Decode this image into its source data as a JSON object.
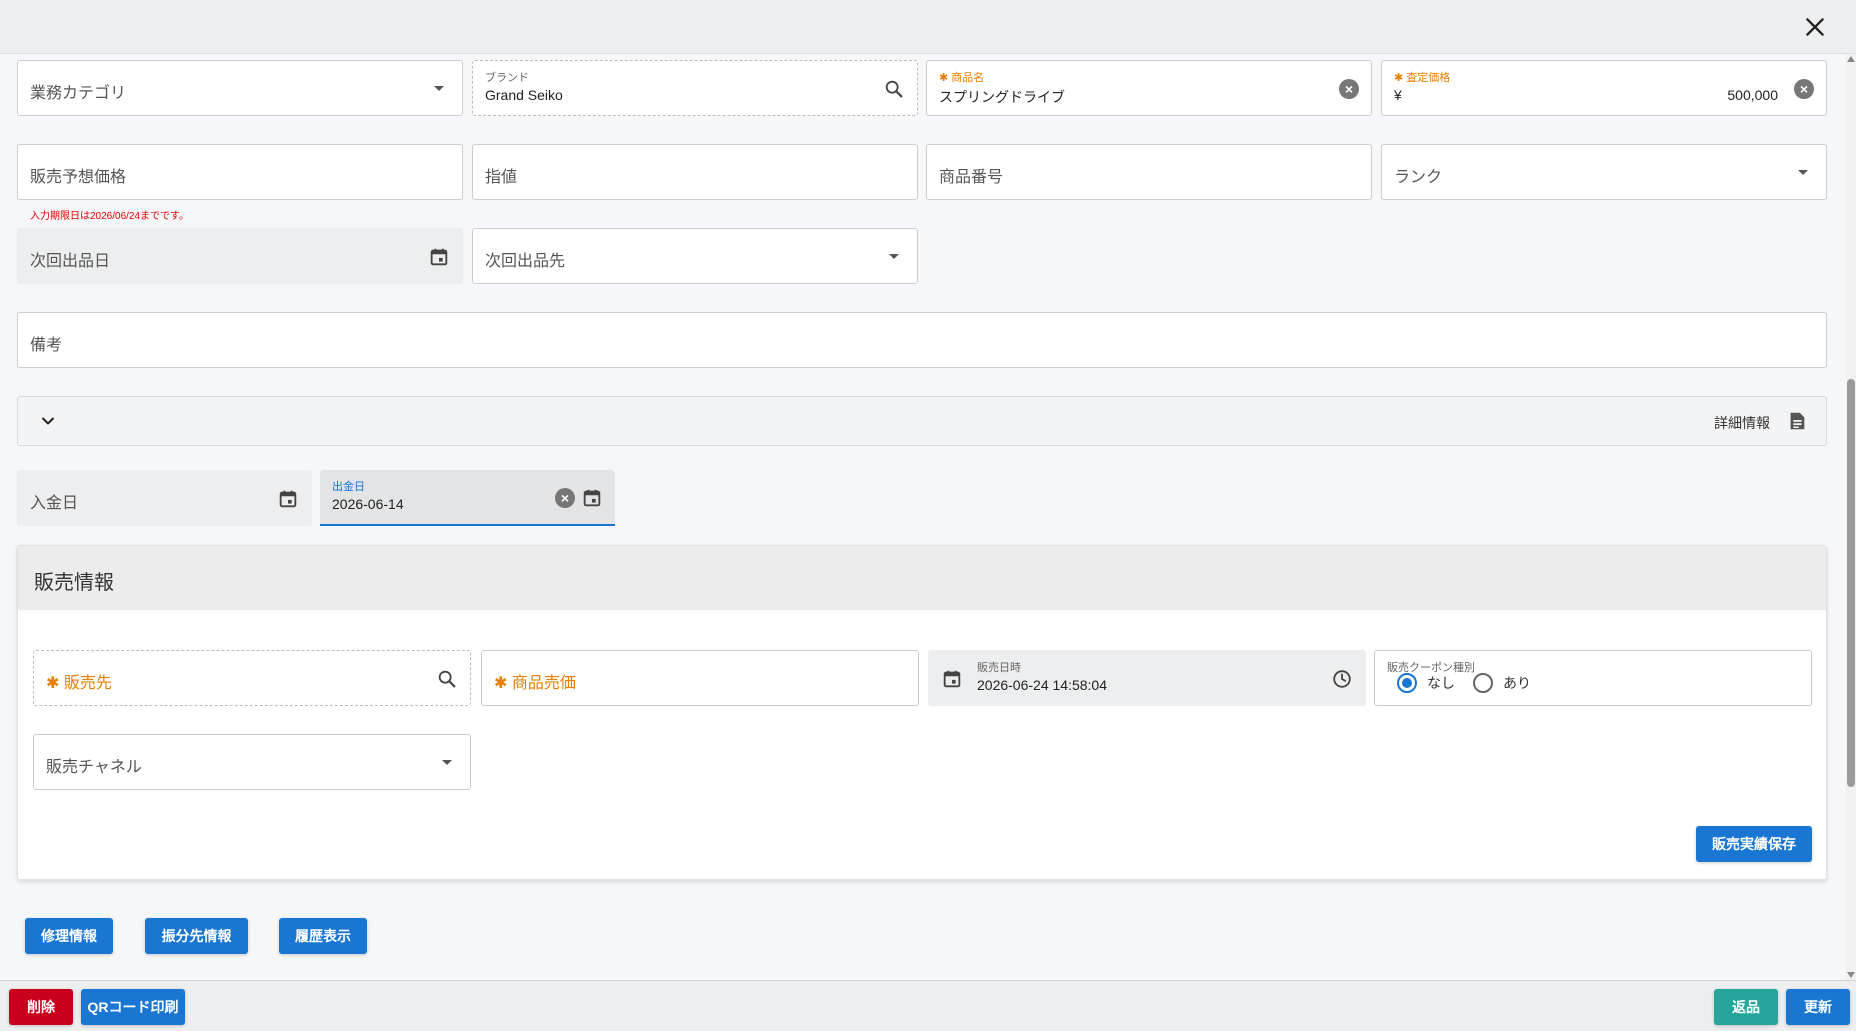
{
  "close_label": "×",
  "fields": {
    "category": {
      "label": "業務カテゴリ"
    },
    "brand": {
      "label": "ブランド",
      "value": "Grand Seiko"
    },
    "product_name": {
      "label": "商品名",
      "value": "スプリングドライブ"
    },
    "appraisal_price": {
      "label": "査定価格",
      "currency": "¥",
      "value": "500,000"
    },
    "expected_price": {
      "label": "販売予想価格"
    },
    "limit_price": {
      "label": "指値"
    },
    "product_number": {
      "label": "商品番号"
    },
    "rank": {
      "label": "ランク"
    },
    "input_deadline_hint": "入力期限日は2026/06/24までです。",
    "next_listing_date": {
      "label": "次回出品日"
    },
    "next_listing_dest": {
      "label": "次回出品先"
    },
    "notes": {
      "label": "備考"
    },
    "payment_date": {
      "label": "入金日"
    },
    "shipping_date": {
      "label": "出金日",
      "value": "2026-06-14"
    }
  },
  "accordion": {
    "label": "詳細情報"
  },
  "sales_panel": {
    "title": "販売情報",
    "buyer": {
      "label": "販売先"
    },
    "sale_price": {
      "label": "商品売価"
    },
    "sale_datetime": {
      "label": "販売日時",
      "value": "2026-06-24 14:58:04"
    },
    "coupon": {
      "label": "販売クーポン種別",
      "options": [
        "なし",
        "あり"
      ],
      "selected": "なし"
    },
    "channel": {
      "label": "販売チャネル"
    },
    "save_button": "販売実績保存"
  },
  "section_buttons": {
    "repair": "修理情報",
    "transfer": "振分先情報",
    "history": "履歴表示"
  },
  "footer": {
    "delete": "削除",
    "qr_print": "QRコード印刷",
    "return": "返品",
    "update": "更新"
  },
  "colors": {
    "primary": "#1976d2",
    "danger": "#c8001e",
    "teal": "#26a69a",
    "required": "#e67e00"
  }
}
